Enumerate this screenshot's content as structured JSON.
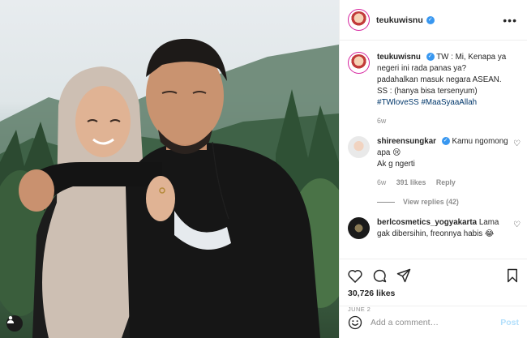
{
  "header": {
    "username": "teukuwisnu",
    "verified": true
  },
  "caption": {
    "username": "teukuwisnu",
    "text_line1": "TW : Mi, Kenapa ya negeri ini rada panas ya? padahalkan masuk negara ASEAN.",
    "text_line2": "SS : (hanya bisa tersenyum)",
    "hashtags": [
      "#TWloveSS",
      "#MaaSyaaAllah"
    ],
    "time": "6w"
  },
  "comments": [
    {
      "username": "shireensungkar",
      "verified": true,
      "text": "Kamu ngomong apa 😢",
      "text2": "Ak g ngerti",
      "time": "6w",
      "likes": "391 likes",
      "reply_label": "Reply",
      "view_replies": "View replies (42)"
    },
    {
      "username": "berlcosmetics_yogyakarta",
      "verified": false,
      "text": "Lama gak dibersihin, freonnya habis 😂"
    }
  ],
  "likes_count": "30,726 likes",
  "post_date": "JUNE 2",
  "add_comment": {
    "placeholder": "Add a comment…",
    "post_label": "Post"
  },
  "icons": {
    "more": "more-options-icon",
    "heart": "heart-icon",
    "comment": "comment-icon",
    "share": "share-icon",
    "save": "bookmark-icon",
    "emoji": "emoji-icon",
    "user_tag": "user-tag-icon"
  },
  "colors": {
    "verified": "#3897f0",
    "hashtag": "#00376b",
    "muted": "#8e8e8e",
    "post_button": "#b2dffc"
  }
}
